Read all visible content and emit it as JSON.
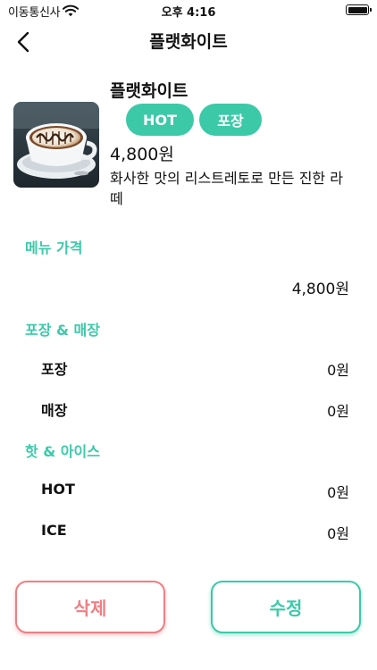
{
  "status_bar": {
    "carrier": "이동통신사",
    "time": "오후 4:16",
    "icons": [
      "wifi-icon",
      "battery-icon"
    ]
  },
  "nav": {
    "title": "플랫화이트",
    "back_icon": "chevron-left-icon"
  },
  "product": {
    "name": "플랫화이트",
    "tags": [
      "HOT",
      "포장"
    ],
    "price": "4,800원",
    "description": "화사한 맛의 리스트레토로 만든 진한 라떼",
    "image": "flat-white-latte-photo"
  },
  "sections": {
    "menu_price": {
      "title": "메뉴 가격",
      "value": "4,800원"
    },
    "takeout": {
      "title": "포장 & 매장",
      "options": [
        {
          "label": "포장",
          "price": "0원"
        },
        {
          "label": "매장",
          "price": "0원"
        }
      ]
    },
    "temperature": {
      "title": "핫 & 아이스",
      "options": [
        {
          "label": "HOT",
          "price": "0원"
        },
        {
          "label": "ICE",
          "price": "0원"
        }
      ]
    }
  },
  "buttons": {
    "delete": "삭제",
    "edit": "수정"
  },
  "colors": {
    "accent": "#3cc9a8",
    "danger": "#ef7f84",
    "text": "#111111"
  }
}
